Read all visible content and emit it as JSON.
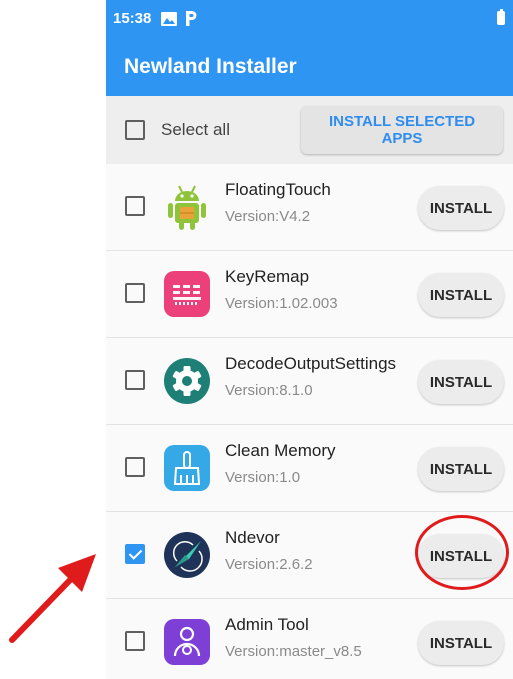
{
  "status_bar": {
    "time": "15:38",
    "icons": [
      "image-icon",
      "parking-icon",
      "battery-icon"
    ]
  },
  "app_bar": {
    "title": "Newland Installer"
  },
  "toolbar": {
    "select_all_label": "Select all",
    "select_all_checked": false,
    "install_selected_label": "INSTALL SELECTED APPS"
  },
  "apps": [
    {
      "name": "FloatingTouch",
      "version": "Version:V4.2",
      "checked": false,
      "install_label": "INSTALL",
      "icon": "android-robot-icon"
    },
    {
      "name": "KeyRemap",
      "version": "Version:1.02.003",
      "checked": false,
      "install_label": "INSTALL",
      "icon": "keyboard-icon"
    },
    {
      "name": "DecodeOutputSettings",
      "version": "Version:8.1.0",
      "checked": false,
      "install_label": "INSTALL",
      "icon": "settings-gear-icon"
    },
    {
      "name": "Clean Memory",
      "version": "Version:1.0",
      "checked": false,
      "install_label": "INSTALL",
      "icon": "broom-icon"
    },
    {
      "name": "Ndevor",
      "version": "Version:2.6.2",
      "checked": true,
      "install_label": "INSTALL",
      "icon": "ndevor-logo-icon"
    },
    {
      "name": "Admin Tool",
      "version": "Version:master_v8.5",
      "checked": false,
      "install_label": "INSTALL",
      "icon": "admin-user-icon"
    }
  ],
  "colors": {
    "primary": "#2f95f3",
    "annotation": "#e01b1b"
  }
}
